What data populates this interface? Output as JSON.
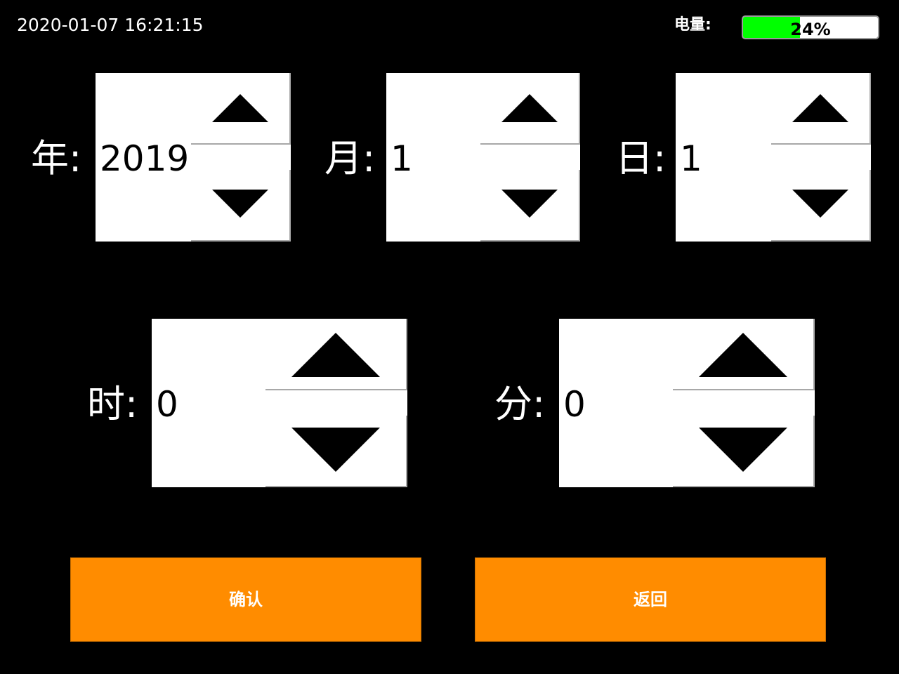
{
  "status": {
    "datetime": "2020-01-07 16:21:15",
    "battery_label": "电量:",
    "battery_percent_text": "24%",
    "battery_level": 0.42,
    "battery_fill_color": "#00ff00"
  },
  "fields": {
    "year": {
      "label": "年:",
      "value": "2019"
    },
    "month": {
      "label": "月:",
      "value": "1"
    },
    "day": {
      "label": "日:",
      "value": "1"
    },
    "hour": {
      "label": "时:",
      "value": "0"
    },
    "minute": {
      "label": "分:",
      "value": "0"
    }
  },
  "icons": {
    "increment": "triangle-up-icon",
    "decrement": "triangle-down-icon"
  },
  "buttons": {
    "confirm_label": "确认",
    "back_label": "返回",
    "color": "#ff8c00"
  }
}
